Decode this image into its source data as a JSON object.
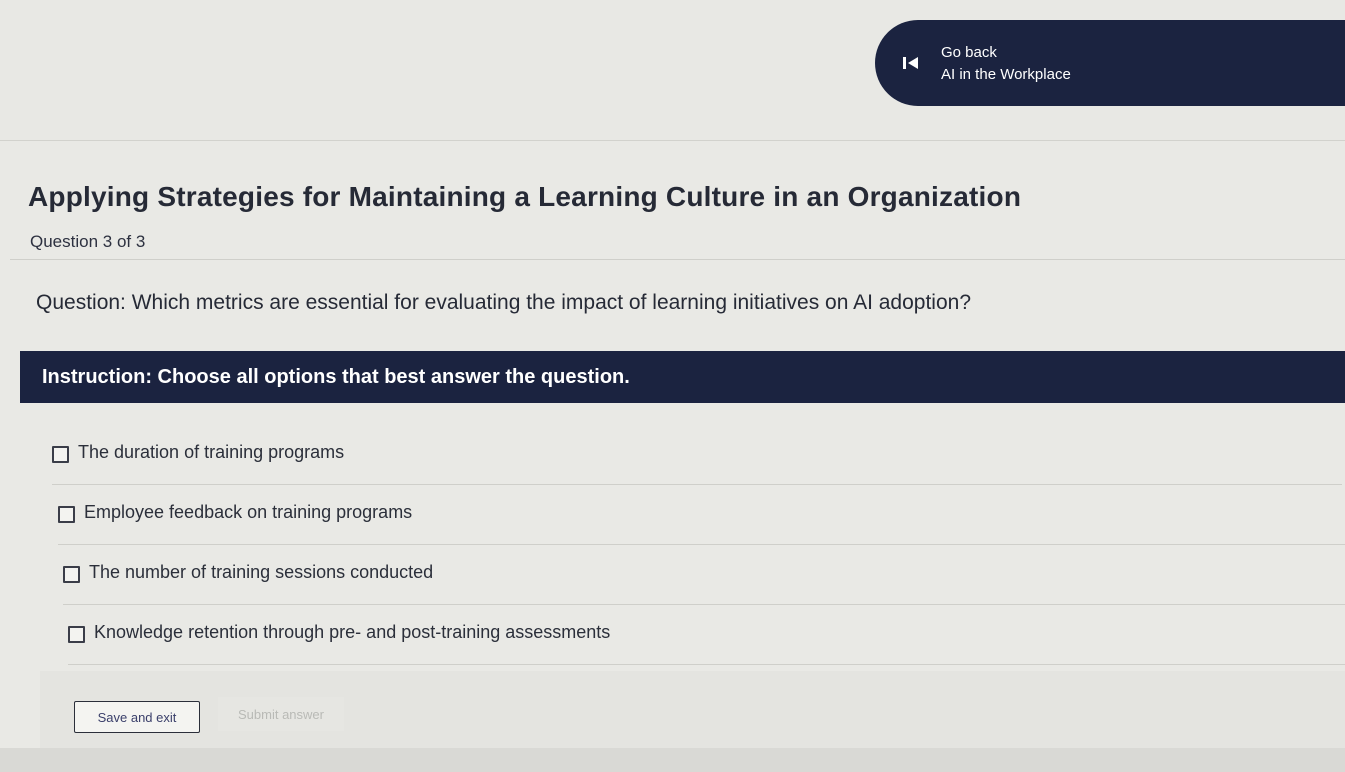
{
  "header": {
    "back_label": "Go back",
    "course_name": "AI in the Workplace"
  },
  "main": {
    "title": "Applying Strategies for Maintaining a Learning Culture in an Organization",
    "question_count": "Question 3 of 3",
    "question": "Question: Which metrics are essential for evaluating the impact of learning initiatives on AI adoption?",
    "instruction": "Instruction: Choose all options that best answer the question.",
    "options": [
      {
        "label": "The duration of training programs",
        "checked": false
      },
      {
        "label": "Employee feedback on training programs",
        "checked": false
      },
      {
        "label": "The number of training sessions conducted",
        "checked": false
      },
      {
        "label": "Knowledge retention through pre- and post-training assessments",
        "checked": false
      }
    ]
  },
  "actions": {
    "save_label": "Save and exit",
    "submit_label": "Submit answer"
  },
  "colors": {
    "navy": "#1b2340",
    "background": "#e9e9e5",
    "disabled_text": "#b9bab6"
  }
}
